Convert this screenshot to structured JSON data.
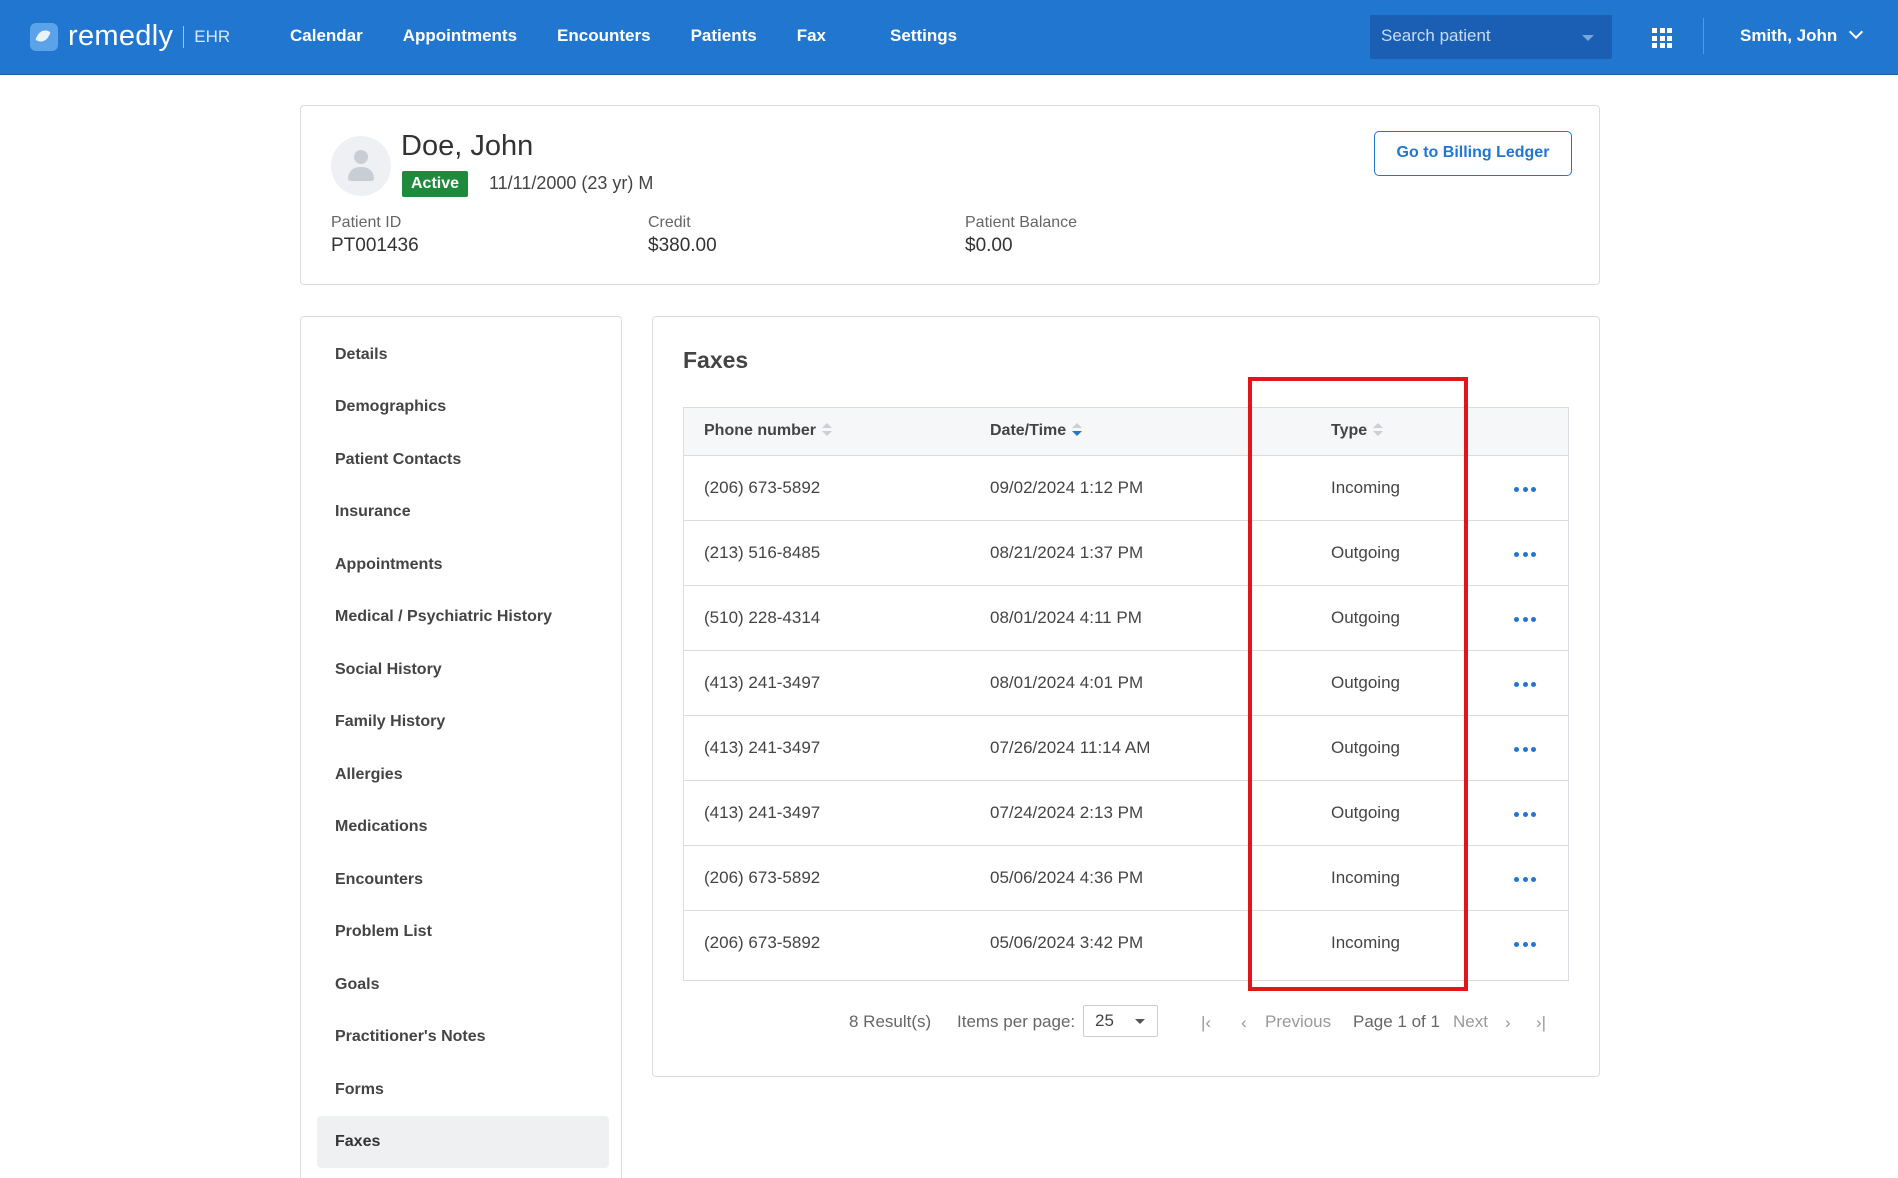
{
  "header": {
    "brand": "remedly",
    "brand_sub": "EHR",
    "nav": [
      "Calendar",
      "Appointments",
      "Encounters",
      "Patients",
      "Fax",
      "Settings"
    ],
    "search_placeholder": "Search patient",
    "user": "Smith, John"
  },
  "patient": {
    "name": "Doe, John",
    "status": "Active",
    "dob_line": "11/11/2000 (23 yr) M",
    "id_label": "Patient ID",
    "id": "PT001436",
    "credit_label": "Credit",
    "credit": "$380.00",
    "balance_label": "Patient Balance",
    "balance": "$0.00",
    "billing_button": "Go to Billing Ledger"
  },
  "sidebar": {
    "items": [
      "Details",
      "Demographics",
      "Patient Contacts",
      "Insurance",
      "Appointments",
      "Medical / Psychiatric History",
      "Social History",
      "Family History",
      "Allergies",
      "Medications",
      "Encounters",
      "Problem List",
      "Goals",
      "Practitioner's Notes",
      "Forms",
      "Faxes"
    ],
    "active": "Faxes"
  },
  "faxes": {
    "title": "Faxes",
    "columns": [
      "Phone number",
      "Date/Time",
      "Type"
    ],
    "rows": [
      {
        "phone": "(206) 673-5892",
        "datetime": "09/02/2024 1:12 PM",
        "type": "Incoming"
      },
      {
        "phone": "(213) 516-8485",
        "datetime": "08/21/2024 1:37 PM",
        "type": "Outgoing"
      },
      {
        "phone": "(510) 228-4314",
        "datetime": "08/01/2024 4:11 PM",
        "type": "Outgoing"
      },
      {
        "phone": "(413) 241-3497",
        "datetime": "08/01/2024 4:01 PM",
        "type": "Outgoing"
      },
      {
        "phone": "(413) 241-3497",
        "datetime": "07/26/2024 11:14 AM",
        "type": "Outgoing"
      },
      {
        "phone": "(413) 241-3497",
        "datetime": "07/24/2024 2:13 PM",
        "type": "Outgoing"
      },
      {
        "phone": "(206) 673-5892",
        "datetime": "05/06/2024 4:36 PM",
        "type": "Incoming"
      },
      {
        "phone": "(206) 673-5892",
        "datetime": "05/06/2024 3:42 PM",
        "type": "Incoming"
      }
    ],
    "results": "8 Result(s)",
    "items_per_page_label": "Items per page:",
    "items_per_page": "25",
    "previous": "Previous",
    "page_info": "Page 1 of 1",
    "next": "Next"
  },
  "colors": {
    "primary": "#2176d0",
    "active_badge": "#1e8a3c",
    "highlight": "#e0161b"
  }
}
